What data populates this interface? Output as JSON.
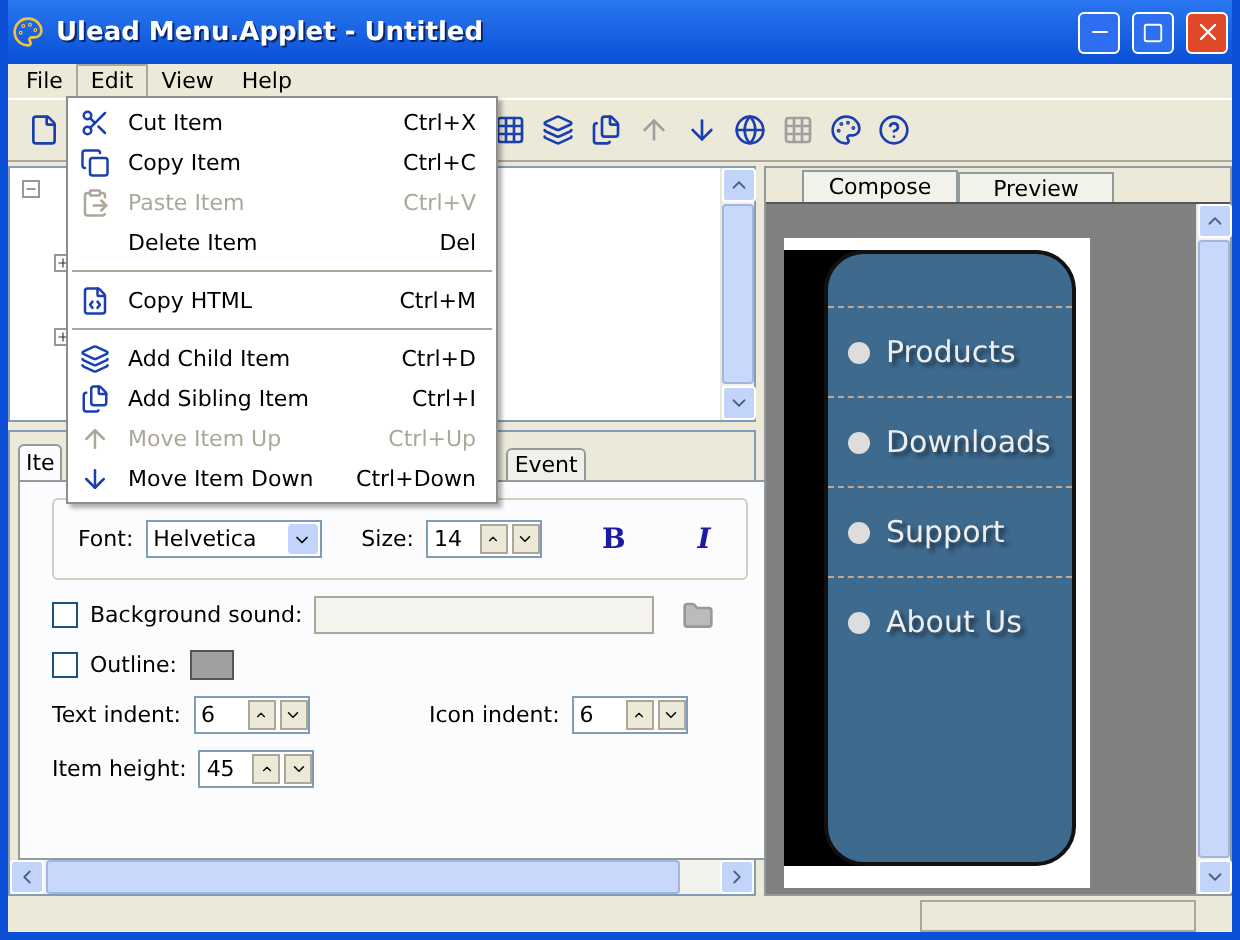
{
  "window": {
    "title": "Ulead Menu.Applet - Untitled"
  },
  "menubar": [
    {
      "label": "File",
      "selected": false
    },
    {
      "label": "Edit",
      "selected": true
    },
    {
      "label": "View",
      "selected": false
    },
    {
      "label": "Help",
      "selected": false
    }
  ],
  "edit_menu": [
    {
      "kind": "cut",
      "label": "Cut Item",
      "shortcut": "Ctrl+X",
      "disabled": false
    },
    {
      "kind": "copy",
      "label": "Copy Item",
      "shortcut": "Ctrl+C",
      "disabled": false
    },
    {
      "kind": "paste",
      "label": "Paste Item",
      "shortcut": "Ctrl+V",
      "disabled": true
    },
    {
      "kind": "delete",
      "label": "Delete Item",
      "shortcut": "Del",
      "disabled": false
    },
    {
      "kind": "separator"
    },
    {
      "kind": "copy-html",
      "label": "Copy HTML",
      "shortcut": "Ctrl+M",
      "disabled": false
    },
    {
      "kind": "separator"
    },
    {
      "kind": "add-child",
      "label": "Add Child Item",
      "shortcut": "Ctrl+D",
      "disabled": false
    },
    {
      "kind": "add-sibling",
      "label": "Add Sibling Item",
      "shortcut": "Ctrl+I",
      "disabled": false
    },
    {
      "kind": "move-up",
      "label": "Move Item Up",
      "shortcut": "Ctrl+Up",
      "disabled": true
    },
    {
      "kind": "move-down",
      "label": "Move Item Down",
      "shortcut": "Ctrl+Down",
      "disabled": false
    }
  ],
  "toolbar": [
    {
      "kind": "new",
      "disabled": false
    },
    {
      "kind": "gap"
    },
    {
      "kind": "layout",
      "disabled": false
    },
    {
      "kind": "add-child",
      "disabled": false
    },
    {
      "kind": "add-sibling",
      "disabled": false
    },
    {
      "kind": "move-up",
      "disabled": true
    },
    {
      "kind": "move-down",
      "disabled": false
    },
    {
      "kind": "browser",
      "disabled": false
    },
    {
      "kind": "grid",
      "disabled": true
    },
    {
      "kind": "color",
      "disabled": false
    },
    {
      "kind": "help",
      "disabled": false
    }
  ],
  "properties": {
    "tabs": [
      {
        "label": "Ite",
        "selected": true
      },
      {
        "label": "Event",
        "selected": false
      }
    ],
    "font": {
      "label": "Font:",
      "value": "Helvetica"
    },
    "size": {
      "label": "Size:",
      "value": "14"
    },
    "bold_button": "B",
    "italic_button": "I",
    "background_sound": {
      "label": "Background sound:",
      "checked": false
    },
    "outline": {
      "label": "Outline:",
      "checked": false
    },
    "text_indent": {
      "label": "Text indent:",
      "value": "6"
    },
    "icon_indent": {
      "label": "Icon indent:",
      "value": "6"
    },
    "item_height": {
      "label": "Item height:",
      "value": "45"
    }
  },
  "preview": {
    "tabs": [
      {
        "label": "Compose",
        "selected": true
      },
      {
        "label": "Preview",
        "selected": false
      }
    ],
    "items": [
      "Products",
      "Downloads",
      "Support",
      "About Us"
    ]
  }
}
